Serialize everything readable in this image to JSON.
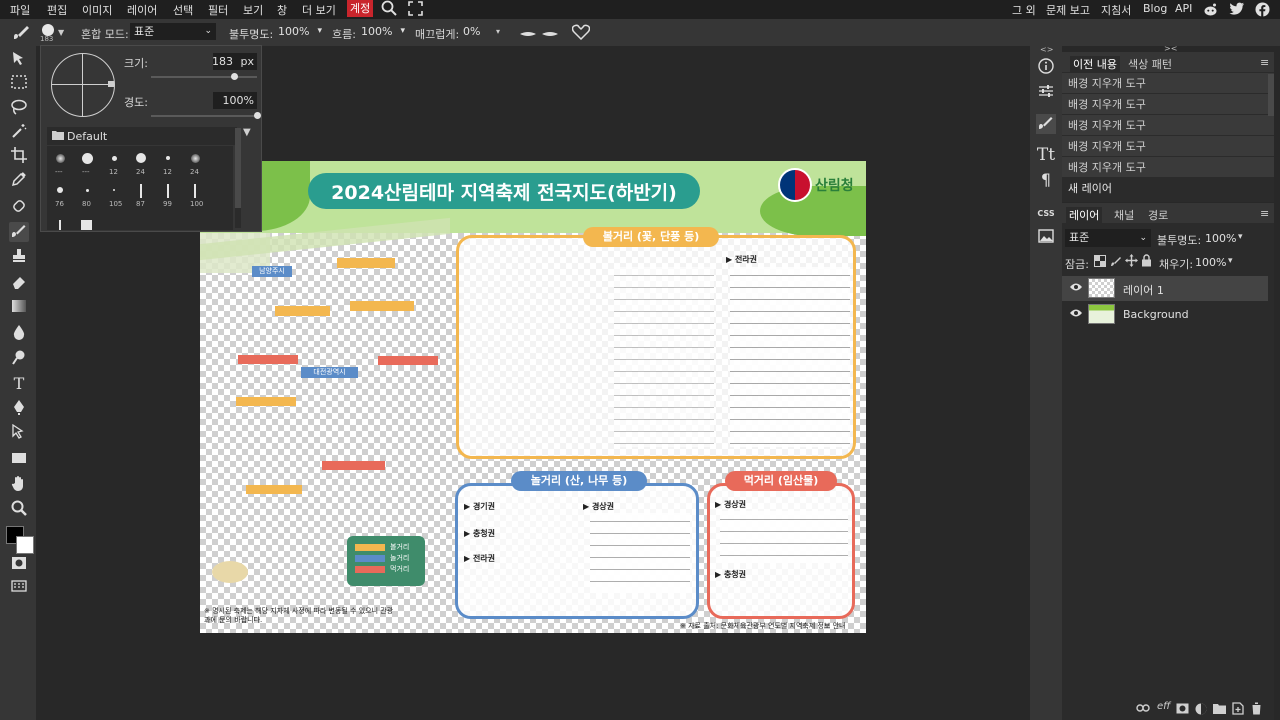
{
  "menubar": {
    "items": [
      "파일",
      "편집",
      "이미지",
      "레이어",
      "선택",
      "필터",
      "보기",
      "창",
      "더 보기",
      "계정"
    ],
    "right": [
      "그 외",
      "문제 보고",
      "지침서",
      "Blog",
      "API"
    ]
  },
  "options": {
    "brush_size_badge": "183",
    "blend_mode_label": "혼합 모드:",
    "blend_mode_value": "표준",
    "opacity_label": "불투명도:",
    "opacity_value": "100%",
    "flow_label": "흐름:",
    "flow_value": "100%",
    "smooth_label": "매끄럽게:",
    "smooth_value": "0%"
  },
  "brush_popup": {
    "size_label": "크기:",
    "size_value": "183",
    "size_unit": "px",
    "size_level": 0.78,
    "hardness_label": "경도:",
    "hardness_value": "100%",
    "hardness_level": 1.0,
    "folder_name": "Default",
    "presets": [
      {
        "label": "---"
      },
      {
        "label": "---"
      },
      {
        "label": "12"
      },
      {
        "label": "24"
      },
      {
        "label": "12"
      },
      {
        "label": "24"
      },
      {
        "label": "76"
      },
      {
        "label": "80"
      },
      {
        "label": "105"
      },
      {
        "label": "87"
      },
      {
        "label": "99"
      },
      {
        "label": "100"
      }
    ]
  },
  "document": {
    "title": "2024산림테마 지역축제 전국지도(하반기)",
    "logo_text": "산림청",
    "section_flower": "볼거리 (꽃, 단풍 등)",
    "section_mountain": "놀거리 (산, 나무 등)",
    "section_food": "먹거리 (임산물)",
    "region_jeolla": "▶ 전라권",
    "region_gyeonggi": "▶ 경기권",
    "region_chungcheong": "▶ 충청권",
    "region_jeolla2": "▶ 전라권",
    "region_gyeongsang": "▶ 경상권",
    "region_gyeongsang2": "▶ 경상권",
    "region_chungcheong2": "▶ 충청권",
    "footer_source": "※ 자료 출처: 문화체육관광부 연도별 지역축제 정보 안내",
    "footer_note": "※ 명시된 축제는 해당 지자체 사정에 따라 변동될 수 있으니 관광과에 문의 바랍니다.",
    "legend": [
      "볼거리",
      "놀거리",
      "먹거리"
    ],
    "map_labels": [
      "남양주시",
      "대전광역시"
    ]
  },
  "history": {
    "tabs": [
      "이전 내용",
      "색상 패턴"
    ],
    "items": [
      "배경 지우개 도구",
      "배경 지우개 도구",
      "배경 지우개 도구",
      "배경 지우개 도구",
      "배경 지우개 도구",
      "새 레이어"
    ]
  },
  "layers": {
    "tabs": [
      "레이어",
      "채널",
      "경로"
    ],
    "blend_value": "표준",
    "opacity_label": "불투명도:",
    "opacity_value": "100%",
    "lock_label": "잠금:",
    "fill_label": "채우기:",
    "fill_value": "100%",
    "items": [
      {
        "name": "레이어 1"
      },
      {
        "name": "Background"
      }
    ],
    "bottom_text": "eff"
  },
  "colors": {
    "accent_red": "#c9252c",
    "doc_green": "#8cc63f",
    "doc_teal": "#2a9d8f",
    "flower_orange": "#f3b74f",
    "mountain_blue": "#5b8cc8",
    "food_red": "#e86a5a"
  }
}
